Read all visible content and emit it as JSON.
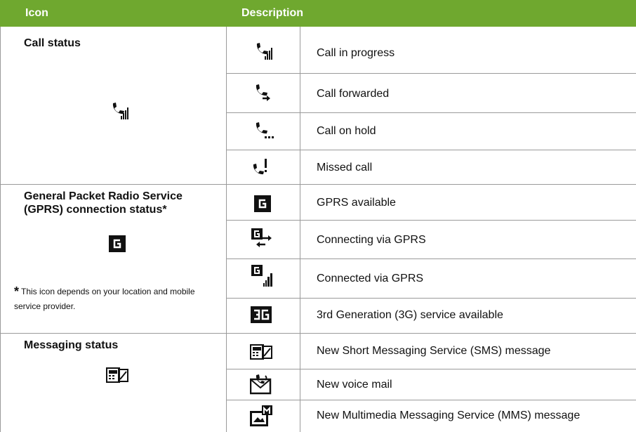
{
  "header": {
    "icon_col": "Icon",
    "description_col": "Description"
  },
  "groups": [
    {
      "title": "Call status",
      "group_icon": "call-in-progress-icon",
      "rows": [
        {
          "icon": "call-in-progress-icon",
          "label": "Call in progress"
        },
        {
          "icon": "call-forwarded-icon",
          "label": "Call forwarded"
        },
        {
          "icon": "call-on-hold-icon",
          "label": "Call on hold"
        },
        {
          "icon": "missed-call-icon",
          "label": "Missed call"
        }
      ]
    },
    {
      "title": "General Packet Radio Service (GPRS) connection status*",
      "group_icon": "gprs-available-icon",
      "note_marker": "*",
      "note": "This icon depends on your location and mobile service provider.",
      "rows": [
        {
          "icon": "gprs-available-icon",
          "label": "GPRS available"
        },
        {
          "icon": "connecting-gprs-icon",
          "label": "Connecting via GPRS"
        },
        {
          "icon": "connected-gprs-icon",
          "label": "Connected via GPRS"
        },
        {
          "icon": "3g-service-icon",
          "label": "3rd Generation (3G) service available"
        }
      ]
    },
    {
      "title": "Messaging status",
      "group_icon": "new-sms-icon",
      "rows": [
        {
          "icon": "new-sms-icon",
          "label": "New Short Messaging Service (SMS) message"
        },
        {
          "icon": "new-voicemail-icon",
          "label": "New voice mail"
        },
        {
          "icon": "new-mms-icon",
          "label": "New Multimedia Messaging Service (MMS) message"
        }
      ]
    }
  ],
  "colors": {
    "header_bg": "#6fa82f",
    "header_text": "#ffffff",
    "grid_line": "#9a9a9a"
  }
}
